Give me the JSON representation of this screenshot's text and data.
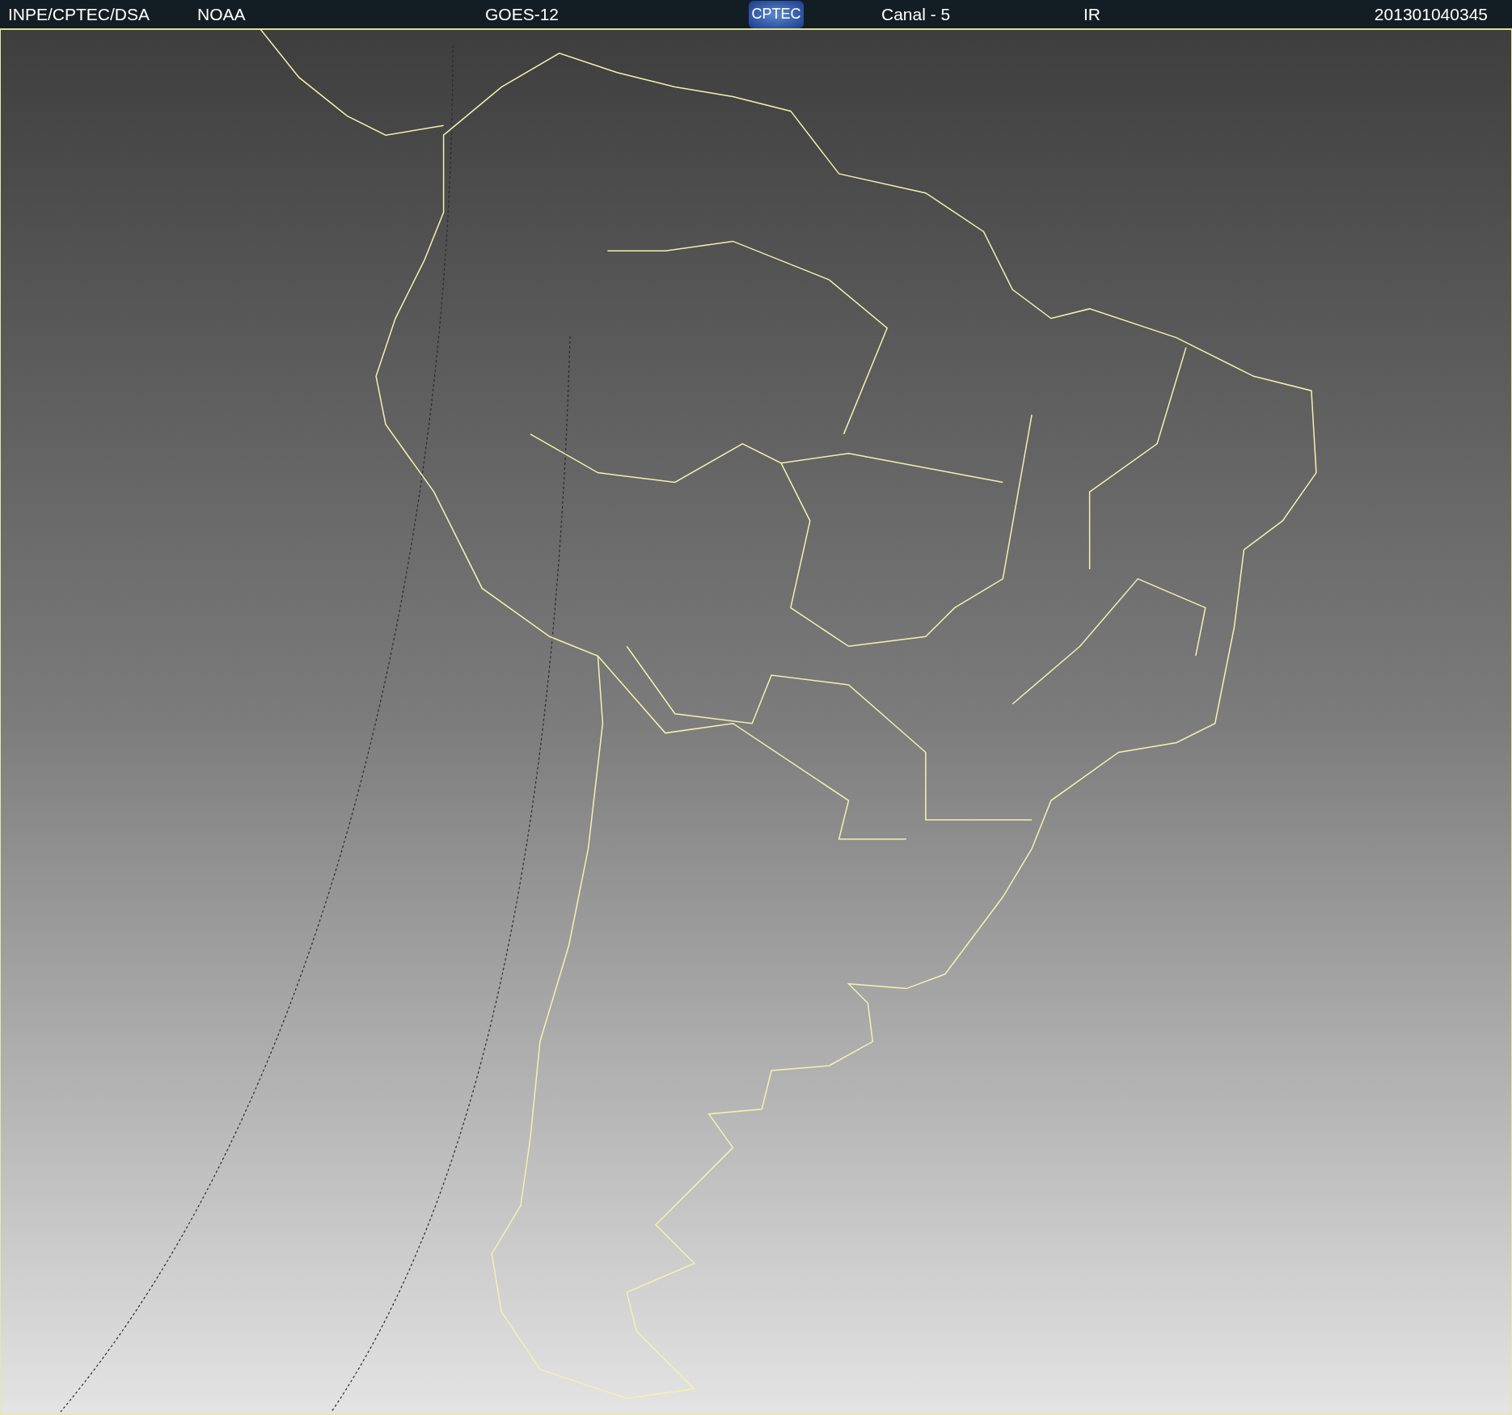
{
  "header": {
    "source": "INPE/CPTEC/DSA",
    "agency": "NOAA",
    "satellite": "GOES-12",
    "logo": "CPTEC",
    "channel": "Canal - 5",
    "band": "IR",
    "timestamp": "201301040345"
  }
}
